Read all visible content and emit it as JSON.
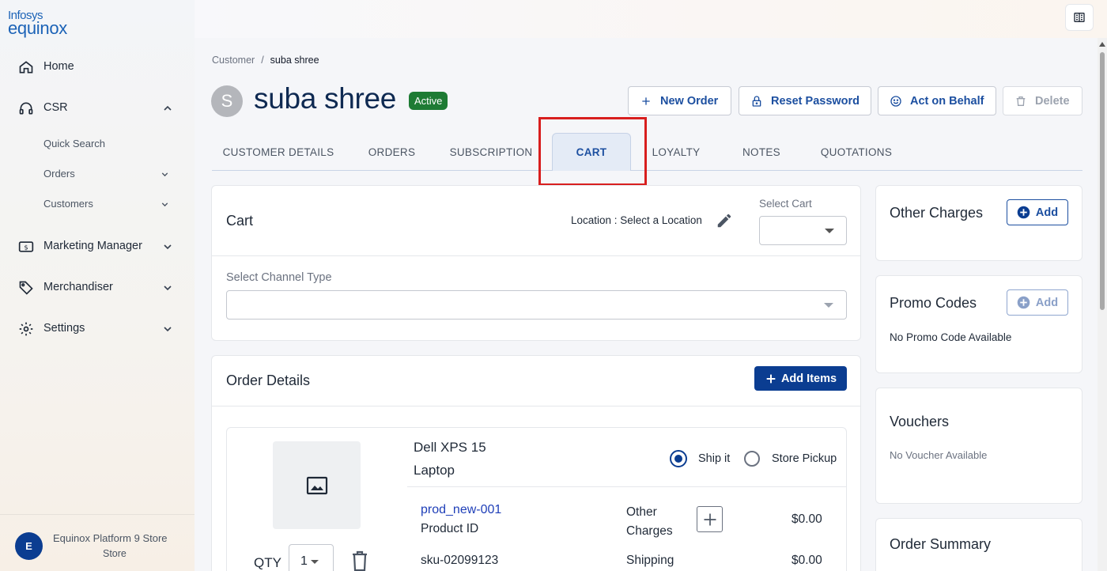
{
  "logo": {
    "line1": "Infosys",
    "line2": "equinox"
  },
  "sidebar": {
    "items": [
      {
        "label": "Home",
        "icon": "home-icon"
      },
      {
        "label": "CSR",
        "icon": "headset-icon"
      },
      {
        "label": "Marketing Manager",
        "icon": "dollar-sign-icon"
      },
      {
        "label": "Merchandiser",
        "icon": "tag-icon"
      },
      {
        "label": "Settings",
        "icon": "gear-icon"
      }
    ],
    "csr_sub": [
      {
        "label": "Quick Search"
      },
      {
        "label": "Orders"
      },
      {
        "label": "Customers"
      }
    ],
    "store": {
      "initial": "E",
      "name": "Equinox Platform 9 Store",
      "type": "Store"
    }
  },
  "breadcrumb": {
    "parent": "Customer",
    "separator": "/",
    "current": "suba shree"
  },
  "customer": {
    "initial": "S",
    "name": "suba shree",
    "status": "Active",
    "status_color": "#1e7b34"
  },
  "actions": {
    "new_order": "New Order",
    "reset_password": "Reset Password",
    "act_on_behalf": "Act on Behalf",
    "delete": "Delete"
  },
  "tabs": [
    "CUSTOMER DETAILS",
    "ORDERS",
    "SUBSCRIPTION",
    "CART",
    "LOYALTY",
    "NOTES",
    "QUOTATIONS"
  ],
  "active_tab": "CART",
  "cart": {
    "title": "Cart",
    "location_text": "Location : Select a Location",
    "select_cart_label": "Select Cart",
    "select_cart_value": "",
    "channel_label": "Select Channel Type",
    "channel_value": ""
  },
  "order_details": {
    "title": "Order Details",
    "add_items_label": "Add Items",
    "item": {
      "name": "Dell XPS 15 Laptop",
      "ship_it": "Ship it",
      "store_pickup": "Store Pickup",
      "selected_fulfillment": "Ship it",
      "product_id_value": "prod_new-001",
      "product_id_label": "Product ID",
      "sku": "sku-02099123",
      "other_charges_label": "Other Charges",
      "other_charges_value": "$0.00",
      "shipping_label": "Shipping",
      "shipping_value": "$0.00",
      "qty_label": "QTY",
      "qty_value": "1"
    }
  },
  "right_panel": {
    "other_charges": {
      "title": "Other Charges",
      "add_label": "Add"
    },
    "promo_codes": {
      "title": "Promo Codes",
      "add_label": "Add",
      "empty": "No Promo Code Available"
    },
    "vouchers": {
      "title": "Vouchers",
      "empty": "No Voucher Available"
    },
    "order_summary": {
      "title": "Order Summary"
    }
  },
  "colors": {
    "primary": "#0b3d91",
    "accent_text": "#1c4fa0",
    "highlight_box": "#d81e1e"
  }
}
